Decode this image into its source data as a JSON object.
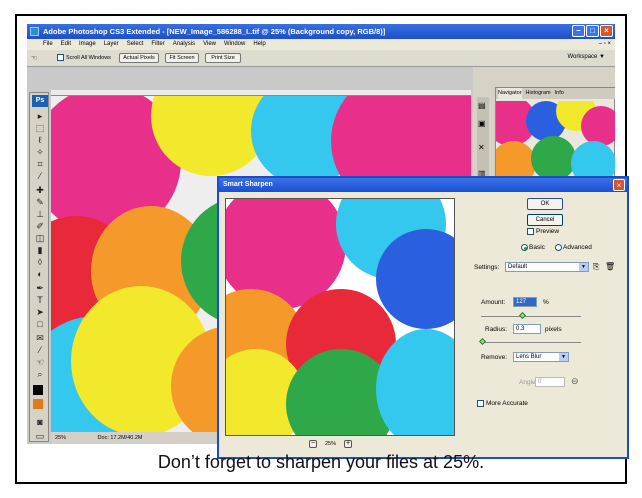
{
  "window": {
    "title": "Adobe Photoshop CS3 Extended - [NEW_Image_586288_I..tif @ 25% (Background copy, RGB/8)]"
  },
  "menu": [
    "File",
    "Edit",
    "Image",
    "Layer",
    "Select",
    "Filter",
    "Analysis",
    "View",
    "Window",
    "Help"
  ],
  "options_bar": {
    "scroll_all": "Scroll All Windows",
    "actual_pixels": "Actual Pixels",
    "fit_screen": "Fit Screen",
    "print_size": "Print Size",
    "workspace": "Workspace ▼"
  },
  "toolbar": {
    "logo": "Ps"
  },
  "status": {
    "zoom": "25%",
    "doc": "Doc: 17.2M/40.2M"
  },
  "navigator": {
    "tabs": [
      "Navigator",
      "Histogram",
      "Info"
    ]
  },
  "dialog": {
    "title": "Smart Sharpen",
    "ok": "OK",
    "cancel": "Cancel",
    "preview": "Preview",
    "basic": "Basic",
    "advanced": "Advanced",
    "settings_label": "Settings:",
    "settings_value": "Default",
    "amount_label": "Amount:",
    "amount_value": "127",
    "amount_unit": "%",
    "radius_label": "Radius:",
    "radius_value": "0.3",
    "radius_unit": "pixels",
    "remove_label": "Remove:",
    "remove_value": "Lens Blur",
    "angle_label": "Angle:",
    "angle_value": "0",
    "more_accurate": "More Accurate",
    "zoom": "25%",
    "amount_level": 0.42,
    "radius_level": 0.02
  },
  "caption": "Don’t forget to sharpen your files at 25%.",
  "colors": {
    "xp_blue": "#1d4cc4",
    "xp_face": "#ece9d8",
    "balloon_pink": "#e8308a",
    "balloon_yellow": "#f2e82c",
    "balloon_blue": "#2a5fe0",
    "balloon_green": "#2fa84a",
    "balloon_cyan": "#35c8ee",
    "balloon_orange": "#f59a2a",
    "balloon_red": "#e8293a"
  }
}
